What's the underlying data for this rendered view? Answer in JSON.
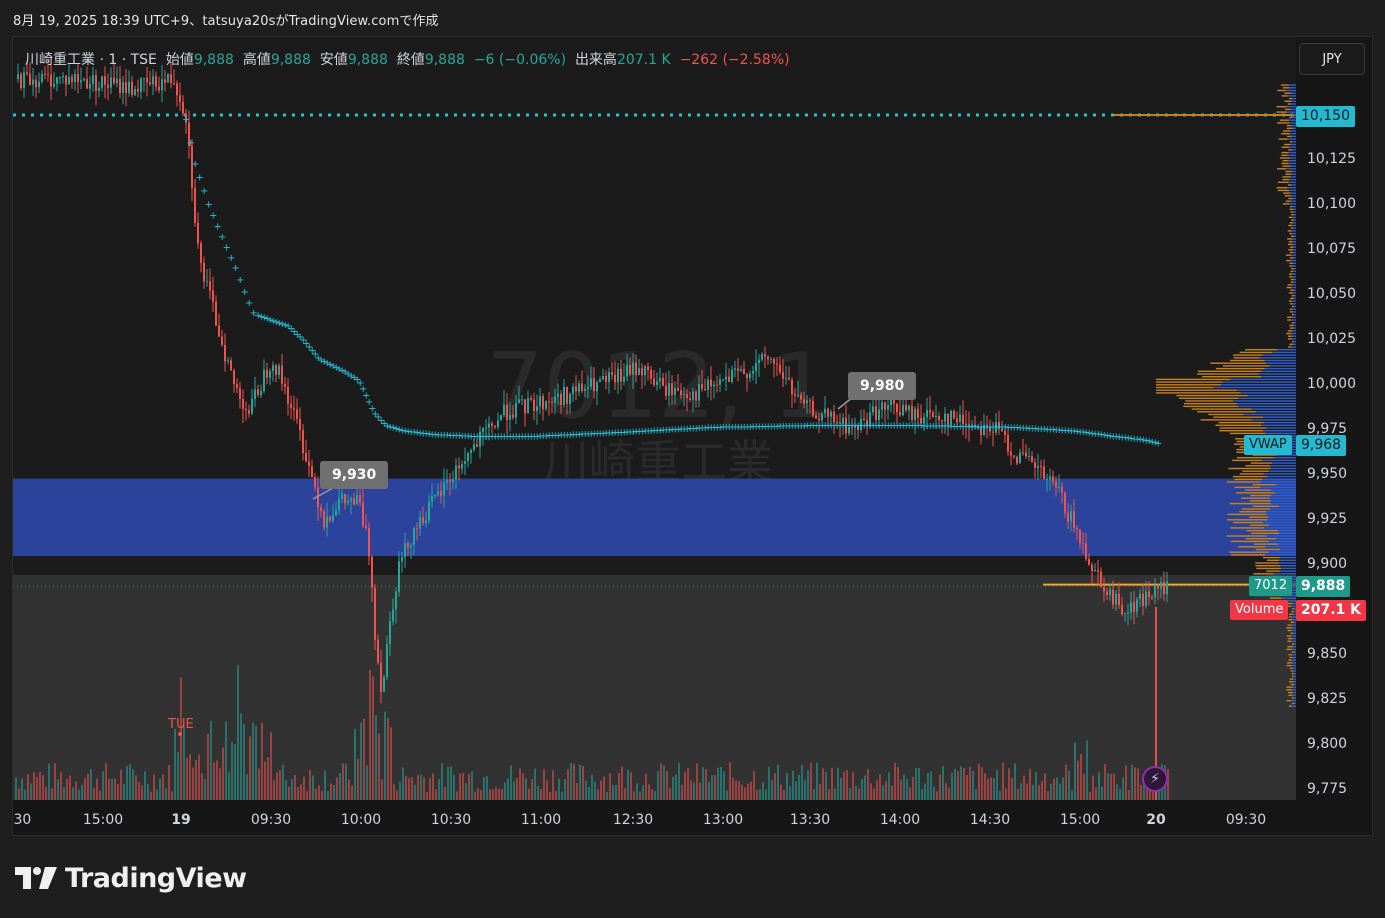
{
  "caption": "8月 19, 2025 18:39 UTC+9、tatsuya20sがTradingView.comで作成",
  "legend": {
    "title": "川崎重工業 · 1 · TSE",
    "open_label": "始値",
    "open_value": "9,888",
    "high_label": "高値",
    "high_value": "9,888",
    "low_label": "安値",
    "low_value": "9,888",
    "close_label": "終値",
    "close_value": "9,888",
    "change": "−6 (−0.06%)",
    "volume_label": "出来高",
    "volume_value": "207.1 K",
    "volume_change": "−262 (−2.58%)"
  },
  "currency": "JPY",
  "watermark": {
    "symbol": "7012, 1",
    "name": "川崎重工業"
  },
  "price_axis": {
    "labels": [
      "10,125",
      "10,100",
      "10,075",
      "10,050",
      "10,025",
      "10,000",
      "9,975",
      "9,950",
      "9,925",
      "9,900",
      "9,850",
      "9,825",
      "9,800",
      "9,775"
    ]
  },
  "price_tags": {
    "line_level": "10,150",
    "vwap_label": "VWAP",
    "vwap_value": "9,968",
    "symbol_label": "7012",
    "last_price": "9,888",
    "volume_label": "Volume",
    "volume_value": "207.1 K"
  },
  "callouts": {
    "low_marker": "9,930",
    "high_marker": "9,980"
  },
  "time_axis": {
    "labels": [
      ":30",
      "15:00",
      "19",
      "09:30",
      "10:00",
      "10:30",
      "11:00",
      "12:30",
      "13:00",
      "13:30",
      "14:00",
      "14:30",
      "15:00",
      "20",
      "09:30"
    ]
  },
  "day_marker": "TUE",
  "brand": {
    "name": "TradingView"
  },
  "colors": {
    "up": "#26a69a",
    "down": "#ef5350",
    "vwap": "#22c3dd",
    "zone": "#2d47a6",
    "profile_up": "#c8811b",
    "profile_down": "#2f5fd0"
  },
  "chart_data": {
    "type": "candlestick",
    "symbol": "7012",
    "interval": "1",
    "exchange": "TSE",
    "price_range": [
      9770,
      10165
    ],
    "zone": [
      9905,
      9948
    ],
    "vwap_end": 9968,
    "last": 9888,
    "markers": [
      {
        "label": "9,930"
      },
      {
        "label": "9,980"
      }
    ],
    "close_path": [
      [
        3,
        10170
      ],
      [
        60,
        10170
      ],
      [
        120,
        10165
      ],
      [
        160,
        10170
      ],
      [
        172,
        10150
      ],
      [
        185,
        10070
      ],
      [
        200,
        10040
      ],
      [
        220,
        10000
      ],
      [
        235,
        9985
      ],
      [
        250,
        10005
      ],
      [
        258,
        10015
      ],
      [
        270,
        10000
      ],
      [
        285,
        9975
      ],
      [
        300,
        9945
      ],
      [
        310,
        9925
      ],
      [
        325,
        9935
      ],
      [
        345,
        9935
      ],
      [
        356,
        9905
      ],
      [
        362,
        9855
      ],
      [
        368,
        9830
      ],
      [
        376,
        9870
      ],
      [
        385,
        9900
      ],
      [
        400,
        9920
      ],
      [
        420,
        9935
      ],
      [
        445,
        9955
      ],
      [
        470,
        9972
      ],
      [
        490,
        9985
      ],
      [
        510,
        9988
      ],
      [
        540,
        9992
      ],
      [
        570,
        9998
      ],
      [
        600,
        10003
      ],
      [
        625,
        10010
      ],
      [
        650,
        9998
      ],
      [
        680,
        9995
      ],
      [
        710,
        10002
      ],
      [
        740,
        10010
      ],
      [
        755,
        10015
      ],
      [
        770,
        10005
      ],
      [
        785,
        9990
      ],
      [
        800,
        9985
      ],
      [
        820,
        9980
      ],
      [
        840,
        9975
      ],
      [
        860,
        9985
      ],
      [
        880,
        9988
      ],
      [
        900,
        9983
      ],
      [
        930,
        9983
      ],
      [
        960,
        9978
      ],
      [
        985,
        9975
      ],
      [
        1000,
        9962
      ],
      [
        1020,
        9955
      ],
      [
        1045,
        9940
      ],
      [
        1065,
        9915
      ],
      [
        1080,
        9898
      ],
      [
        1100,
        9880
      ],
      [
        1115,
        9875
      ],
      [
        1125,
        9880
      ],
      [
        1140,
        9885
      ],
      [
        1155,
        9888
      ]
    ],
    "vwap_path": [
      [
        172,
        10148
      ],
      [
        180,
        10125
      ],
      [
        195,
        10100
      ],
      [
        210,
        10080
      ],
      [
        222,
        10065
      ],
      [
        232,
        10050
      ],
      [
        240,
        10040
      ],
      [
        255,
        10037
      ],
      [
        275,
        10033
      ],
      [
        290,
        10025
      ],
      [
        305,
        10015
      ],
      [
        330,
        10008
      ],
      [
        345,
        10003
      ],
      [
        360,
        9985
      ],
      [
        372,
        9978
      ],
      [
        390,
        9975
      ],
      [
        420,
        9973
      ],
      [
        460,
        9972
      ],
      [
        520,
        9972
      ],
      [
        600,
        9974
      ],
      [
        700,
        9977
      ],
      [
        800,
        9978
      ],
      [
        900,
        9978
      ],
      [
        1000,
        9977
      ],
      [
        1060,
        9975
      ],
      [
        1100,
        9972
      ],
      [
        1130,
        9970
      ],
      [
        1145,
        9968
      ]
    ]
  }
}
